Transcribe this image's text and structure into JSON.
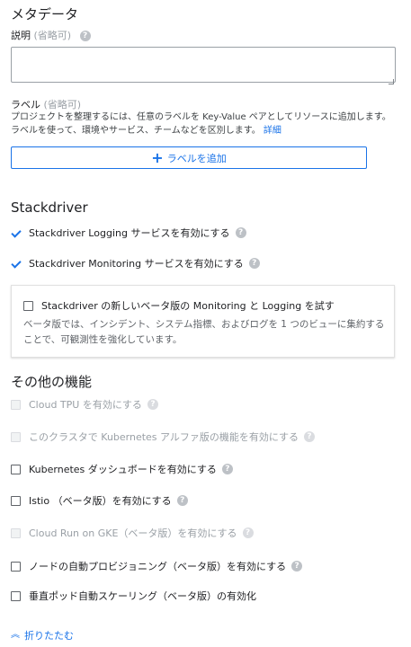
{
  "metadata": {
    "title": "メタデータ",
    "description": {
      "label": "説明",
      "optional": "(省略可)",
      "value": ""
    },
    "labels": {
      "label": "ラベル",
      "optional": "(省略可)",
      "hint": "プロジェクトを整理するには、任意のラベルを Key-Value ペアとしてリソースに追加します。ラベルを使って、環境やサービス、チームなどを区別します。",
      "link": "詳細",
      "add_button": "ラベルを追加"
    }
  },
  "stackdriver": {
    "title": "Stackdriver",
    "logging": {
      "label": "Stackdriver Logging サービスを有効にする",
      "checked": true
    },
    "monitoring": {
      "label": "Stackdriver Monitoring サービスを有効にする",
      "checked": true
    },
    "beta_card": {
      "label": "Stackdriver の新しいベータ版の Monitoring と Logging を試す",
      "checked": false,
      "description": "ベータ版では、インシデント、システム指標、およびログを 1 つのビューに集約することで、可観測性を強化しています。"
    }
  },
  "other_features": {
    "title": "その他の機能",
    "items": [
      {
        "label": "Cloud TPU を有効にする",
        "disabled": true
      },
      {
        "label": "このクラスタで Kubernetes アルファ版の機能を有効にする",
        "disabled": true
      },
      {
        "label": "Kubernetes ダッシュボードを有効にする",
        "disabled": false
      },
      {
        "label": "Istio （ベータ版）を有効にする",
        "disabled": false
      },
      {
        "label": "Cloud Run on GKE（ベータ版）を有効にする",
        "disabled": true
      },
      {
        "label": "ノードの自動プロビジョニング（ベータ版）を有効にする",
        "disabled": false
      },
      {
        "label": "垂直ポッド自動スケーリング（ベータ版）の有効化",
        "disabled": false
      }
    ]
  },
  "collapse_link": "折りたたむ",
  "colors": {
    "accent": "#1a73e8",
    "disabled_text": "#9aa0a6",
    "text": "#202124"
  }
}
